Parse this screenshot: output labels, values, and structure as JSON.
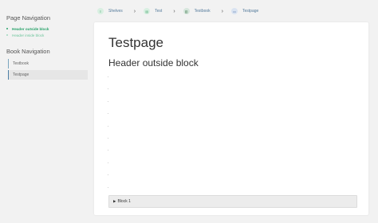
{
  "sidebar": {
    "page_navigation_title": "Page Navigation",
    "page_nav_items": [
      {
        "label": "Header outside block",
        "active": true
      },
      {
        "label": "Header inside block",
        "active": false
      }
    ],
    "book_navigation_title": "Book Navigation",
    "book_items": [
      {
        "label": "Testbook",
        "current": false
      },
      {
        "label": "Testpage",
        "current": true
      }
    ]
  },
  "breadcrumb": [
    {
      "label": "Shelves",
      "icon": "shelves-icon",
      "icon_glyph": "≡",
      "icon_color": "#4aa86e",
      "icon_bg": "#d8efe1"
    },
    {
      "label": "Test",
      "icon": "shelf-icon",
      "icon_glyph": "▤",
      "icon_color": "#4aa86e",
      "icon_bg": "#d8efe1"
    },
    {
      "label": "Testbook",
      "icon": "book-icon",
      "icon_glyph": "▥",
      "icon_color": "#3f7a4f",
      "icon_bg": "#d6e6dc"
    },
    {
      "label": "Testpage",
      "icon": "page-icon",
      "icon_glyph": "▭",
      "icon_color": "#4a6fa8",
      "icon_bg": "#d9e3f1"
    }
  ],
  "main": {
    "title": "Testpage",
    "section_heading": "Header outside block",
    "dot_lines": [
      ".",
      ".",
      ".",
      ".",
      ".",
      ".",
      ".",
      ".",
      ".",
      "."
    ],
    "block_label": "Block 1",
    "block_toggle_icon": "▶"
  },
  "colors": {
    "accent_green": "#2aa36b",
    "background": "#f2f2f2",
    "card": "#ffffff"
  }
}
